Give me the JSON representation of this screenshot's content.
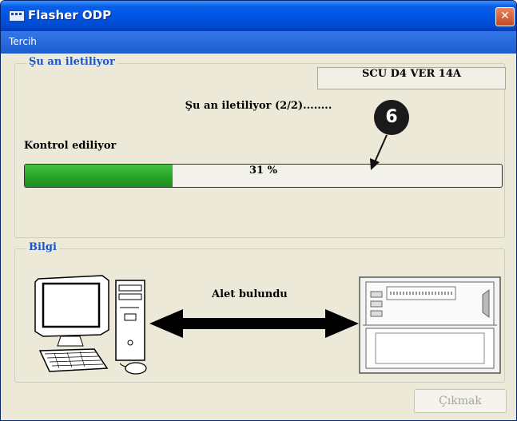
{
  "window": {
    "title": "Flasher ODP",
    "close_glyph": "✕"
  },
  "menu": {
    "items": [
      "Tercih"
    ]
  },
  "transfer_group": {
    "legend": "Şu an iletiliyor",
    "version": "SCU D4 VER  14A",
    "status": "Şu an iletiliyor (2/2)........",
    "check_label": "Kontrol ediliyor",
    "progress_percent": 31,
    "progress_text": "31 %",
    "callout_number": "6"
  },
  "info_group": {
    "legend": "Bilgi",
    "found_text": "Alet bulundu"
  },
  "buttons": {
    "exit": "Çıkmak"
  },
  "icons": {
    "app": "app-window-icon",
    "close": "close-icon",
    "computer": "computer-icon",
    "device": "device-icon",
    "connection": "double-arrow-icon"
  },
  "colors": {
    "titlebar": "#0054e3",
    "legend_text": "#1a56c8",
    "progress_fill": "#26a326",
    "close_button": "#d9633f"
  }
}
